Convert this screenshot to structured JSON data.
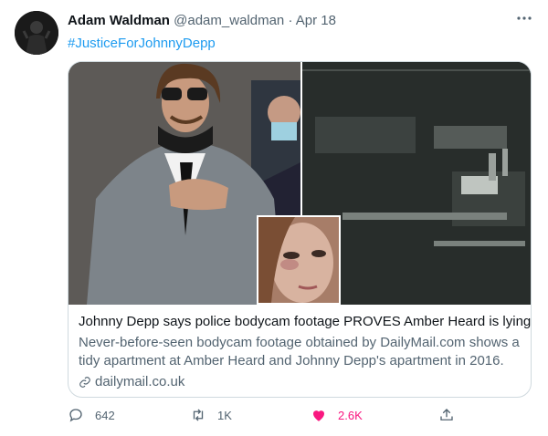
{
  "tweet": {
    "author_name": "Adam Waldman",
    "handle": "@adam_waldman",
    "separator": "·",
    "date": "Apr 18",
    "hashtag": "#JusticeForJohnnyDepp",
    "more_icon": "more-horizontal-icon"
  },
  "card": {
    "title": "Johnny Depp says police bodycam footage PROVES Amber Heard is lying",
    "description": "Never-before-seen bodycam footage obtained by DailyMail.com shows a tidy apartment at Amber Heard and Johnny Depp's apartment in 2016.",
    "domain": "dailymail.co.uk",
    "link_icon": "link-icon"
  },
  "actions": {
    "replies": "642",
    "retweets": "1K",
    "likes": "2.6K",
    "like_color": "#f91880",
    "accent_color": "#1d9bf0"
  }
}
